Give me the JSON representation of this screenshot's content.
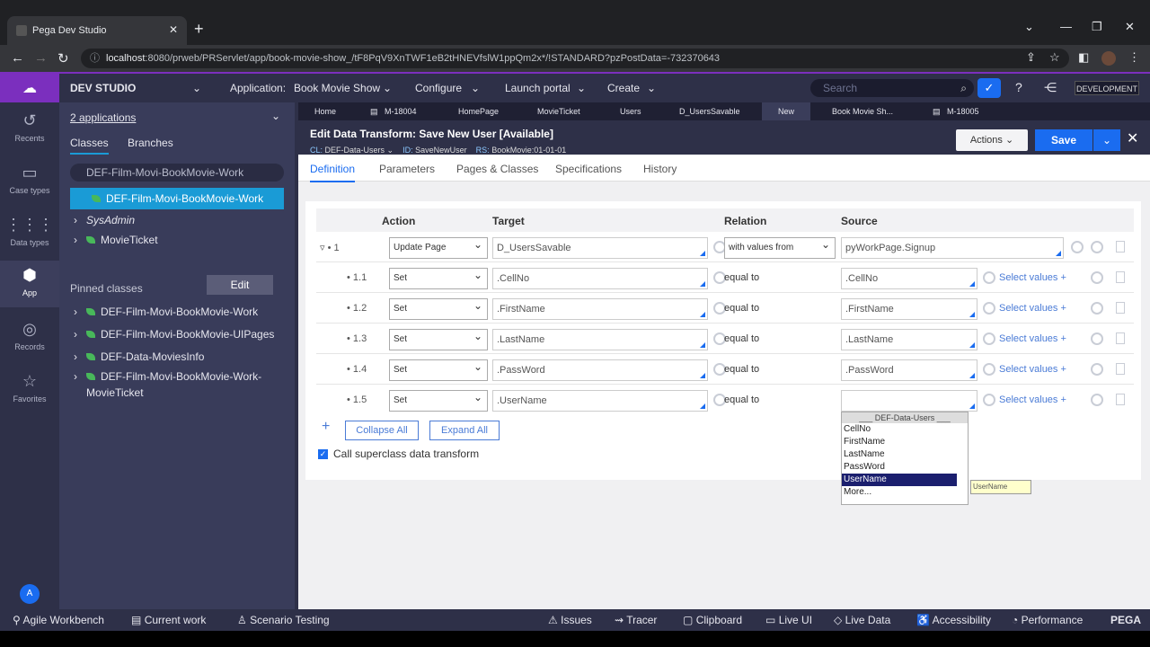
{
  "browser": {
    "tab_title": "Pega Dev Studio",
    "tab_close": "✕",
    "new_tab": "+",
    "url_host": "localhost",
    "url_rest": ":8080/prweb/PRServlet/app/book-movie-show_/tF8PqV9XnTWF1eB2tHNEVfslW1ppQm2x*/!STANDARD?pzPostData=-732370643",
    "window_controls": [
      "⌄",
      "—",
      "❐",
      "✕"
    ]
  },
  "header": {
    "studio": "DEV STUDIO",
    "application_label": "Application:",
    "application_value": "Book Movie Show",
    "configure": "Configure",
    "launch_portal": "Launch portal",
    "create": "Create",
    "search_placeholder": "Search",
    "user_badge": "DEVELOPMENT"
  },
  "rail": {
    "items": [
      "Recents",
      "Case types",
      "Data types",
      "App",
      "Records",
      "Favorites"
    ],
    "avatar": "A"
  },
  "explorer": {
    "apps": "2 applications",
    "tab_classes": "Classes",
    "tab_branches": "Branches",
    "class_input": "DEF-Film-Movi-BookMovie-Work",
    "tree": [
      "DEF-Film-Movi-BookMovie-Work",
      "SysAdmin",
      "MovieTicket"
    ],
    "pinned_title": "Pinned classes",
    "edit": "Edit",
    "pinned": [
      "DEF-Film-Movi-BookMovie-Work",
      "DEF-Film-Movi-BookMovie-UIPages",
      "DEF-Data-MoviesInfo",
      "DEF-Film-Movi-BookMovie-Work-",
      "MovieTicket"
    ]
  },
  "worktabs": [
    "Home",
    "M-18004",
    "HomePage",
    "MovieTicket",
    "Users",
    "D_UsersSavable",
    "New",
    "Book Movie Sh...",
    "M-18005"
  ],
  "rule": {
    "title": "Edit  Data Transform: Save New User [Available]",
    "cl_label": "CL:",
    "cl": "DEF-Data-Users",
    "id_label": "ID:",
    "id": "SaveNewUser",
    "rs_label": "RS:",
    "rs": "BookMovie:01-01-01",
    "actions": "Actions",
    "save": "Save"
  },
  "subtabs": [
    "Definition",
    "Parameters",
    "Pages & Classes",
    "Specifications",
    "History"
  ],
  "grid": {
    "headers": [
      "Action",
      "Target",
      "Relation",
      "Source"
    ],
    "rows": [
      {
        "num": "1",
        "action": "Update Page",
        "target": "D_UsersSavable",
        "relation": "with values from",
        "source": "pyWorkPage.Signup"
      },
      {
        "num": "1.1",
        "action": "Set",
        "target": ".CellNo",
        "relation": "equal to",
        "source": ".CellNo",
        "select": "Select values +"
      },
      {
        "num": "1.2",
        "action": "Set",
        "target": ".FirstName",
        "relation": "equal to",
        "source": ".FirstName",
        "select": "Select values +"
      },
      {
        "num": "1.3",
        "action": "Set",
        "target": ".LastName",
        "relation": "equal to",
        "source": ".LastName",
        "select": "Select values +"
      },
      {
        "num": "1.4",
        "action": "Set",
        "target": ".PassWord",
        "relation": "equal to",
        "source": ".PassWord",
        "select": "Select values +"
      },
      {
        "num": "1.5",
        "action": "Set",
        "target": ".UserName",
        "relation": "equal to",
        "source": "",
        "select": "Select values +"
      }
    ],
    "collapse_all": "Collapse All",
    "expand_all": "Expand All",
    "superclass": "Call superclass data transform"
  },
  "autocomplete": {
    "header": "___ DEF-Data-Users ___",
    "items": [
      "CellNo",
      "FirstName",
      "LastName",
      "PassWord",
      "UserName",
      "More..."
    ],
    "selected": "UserName",
    "tooltip": "UserName"
  },
  "bottombar": [
    "Agile Workbench",
    "Current work",
    "Scenario Testing",
    "Issues",
    "Tracer",
    "Clipboard",
    "Live UI",
    "Live Data",
    "Accessibility",
    "Performance",
    "PEGA"
  ]
}
